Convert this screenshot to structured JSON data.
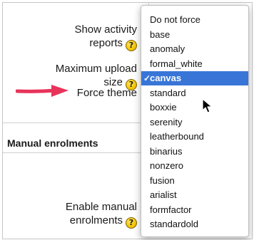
{
  "settings": {
    "show_activity_reports": "Show activity\nreports",
    "max_upload_size": "Maximum upload\nsize",
    "force_theme": "Force theme",
    "enable_manual_enrolments": "Enable manual\nenrolments"
  },
  "help_icon_glyph": "?",
  "section": {
    "manual_enrolments": "Manual enrolments"
  },
  "dropdown": {
    "selected_index": 4,
    "check_glyph": "✓",
    "options": [
      "Do not force",
      "base",
      "anomaly",
      "formal_white",
      "canvas",
      "standard",
      "boxxie",
      "serenity",
      "leatherbound",
      "binarius",
      "nonzero",
      "fusion",
      "arialist",
      "formfactor",
      "standardold"
    ]
  },
  "colors": {
    "selection": "#3875d7",
    "arrow": "#e8335a",
    "help_icon": "#f5c400"
  }
}
